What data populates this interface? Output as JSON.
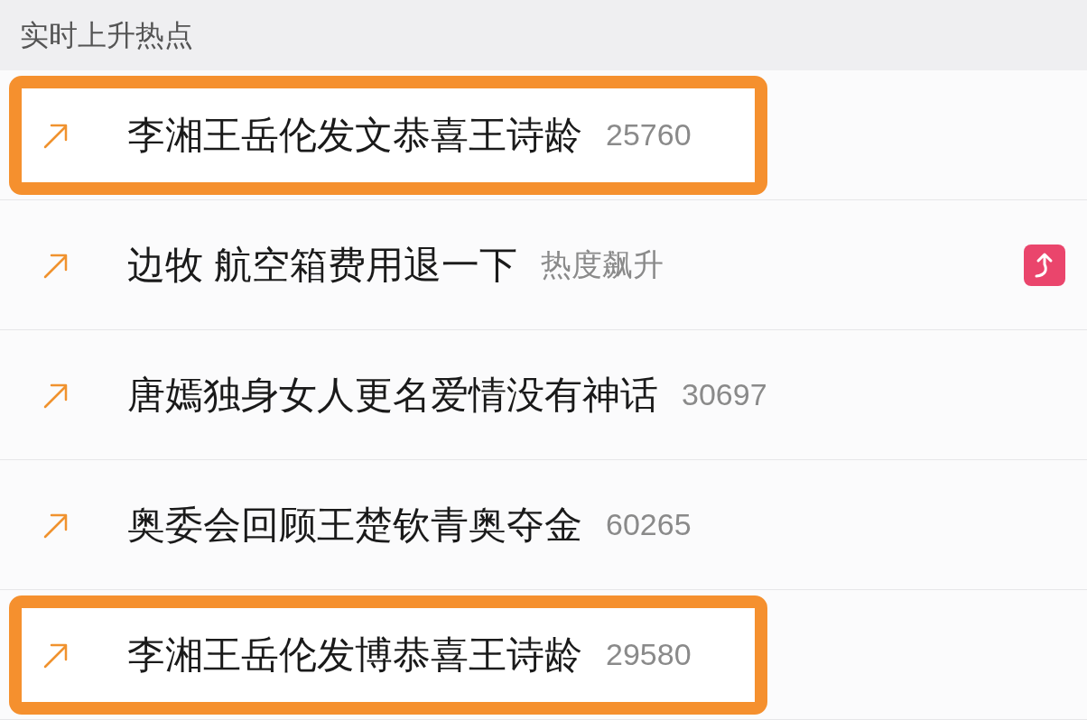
{
  "section_title": "实时上升热点",
  "rows": [
    {
      "title": "李湘王岳伦发文恭喜王诗龄",
      "meta": "25760",
      "highlighted": true,
      "rising_badge": false
    },
    {
      "title": "边牧 航空箱费用退一下",
      "meta": "热度飙升",
      "highlighted": false,
      "rising_badge": true
    },
    {
      "title": "唐嫣独身女人更名爱情没有神话",
      "meta": "30697",
      "highlighted": false,
      "rising_badge": false
    },
    {
      "title": "奥委会回顾王楚钦青奥夺金",
      "meta": "60265",
      "highlighted": false,
      "rising_badge": false
    },
    {
      "title": "李湘王岳伦发博恭喜王诗龄",
      "meta": "29580",
      "highlighted": true,
      "rising_badge": false
    }
  ]
}
